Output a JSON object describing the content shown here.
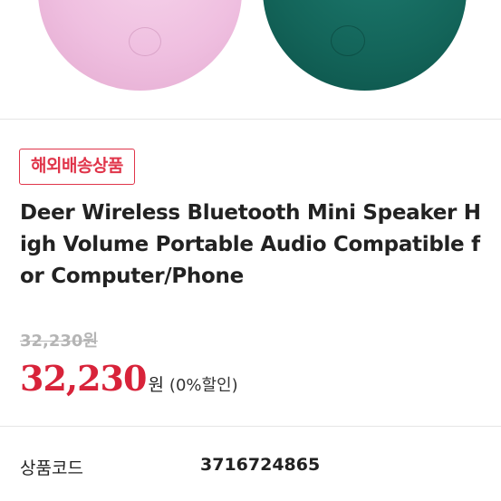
{
  "hero": {
    "image_alt": "pink and teal mini speakers",
    "colors": {
      "pink": "#efbfe0",
      "teal": "#136459"
    }
  },
  "product": {
    "badge": "해외배송상품",
    "title": "Deer Wireless Bluetooth Mini Speaker High Volume Portable Audio Compatible for Computer/Phone",
    "original_price": "32,230원",
    "sale_price": "32,230",
    "sale_unit": "원",
    "discount": "(0%할인)"
  },
  "info": {
    "code_label": "상품코드",
    "code_value": "3716724865"
  },
  "colors": {
    "accent": "#d8233a",
    "badge": "#e0354a",
    "muted": "#b5b5b5"
  }
}
